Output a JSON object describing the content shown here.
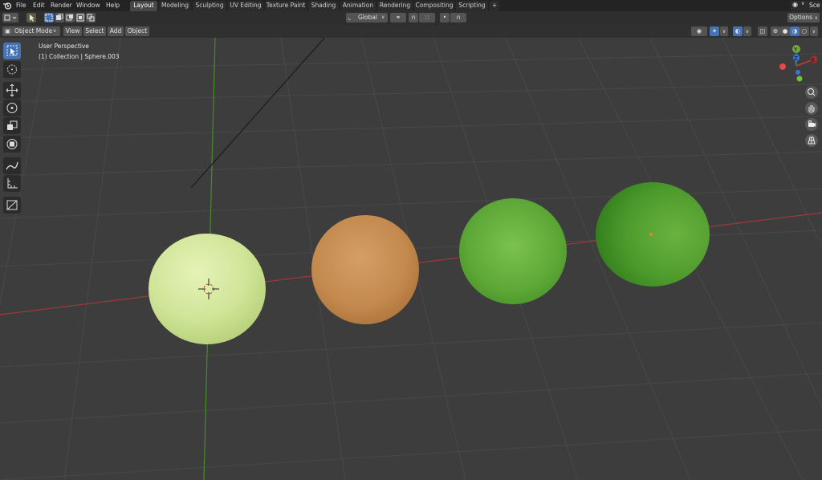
{
  "menu": [
    "File",
    "Edit",
    "Render",
    "Window",
    "Help"
  ],
  "workspaces": [
    {
      "label": "Layout",
      "active": true
    },
    {
      "label": "Modeling",
      "active": false
    },
    {
      "label": "Sculpting",
      "active": false
    },
    {
      "label": "UV Editing",
      "active": false
    },
    {
      "label": "Texture Paint",
      "active": false
    },
    {
      "label": "Shading",
      "active": false
    },
    {
      "label": "Animation",
      "active": false
    },
    {
      "label": "Rendering",
      "active": false
    },
    {
      "label": "Compositing",
      "active": false
    },
    {
      "label": "Scripting",
      "active": false
    }
  ],
  "add_tab": "+",
  "scene_label": "Sce",
  "toolbar": {
    "orientation": "Global",
    "options": "Options"
  },
  "header": {
    "mode": "Object Mode",
    "view": "View",
    "select": "Select",
    "add": "Add",
    "object": "Object"
  },
  "overlay": {
    "perspective": "User Perspective",
    "collection": "(1) Collection | Sphere.003"
  },
  "gizmo": {
    "x": "X",
    "y": "Y",
    "z": "Z"
  },
  "tools": [
    "select-box",
    "cursor",
    "move",
    "rotate",
    "scale",
    "transform",
    "annotate",
    "measure",
    "add-cube"
  ],
  "spheres": [
    {
      "name": "sphere-light-green",
      "color": "#cfe598"
    },
    {
      "name": "sphere-orange",
      "color": "#c98f55"
    },
    {
      "name": "sphere-green",
      "color": "#5ea838"
    },
    {
      "name": "sphere-dark-green",
      "color": "#4c9a2c"
    }
  ],
  "colors": {
    "accent": "#4772b3",
    "x_axis": "#9c3a3a",
    "y_axis": "#4a8a2f",
    "grid": "#494949"
  }
}
